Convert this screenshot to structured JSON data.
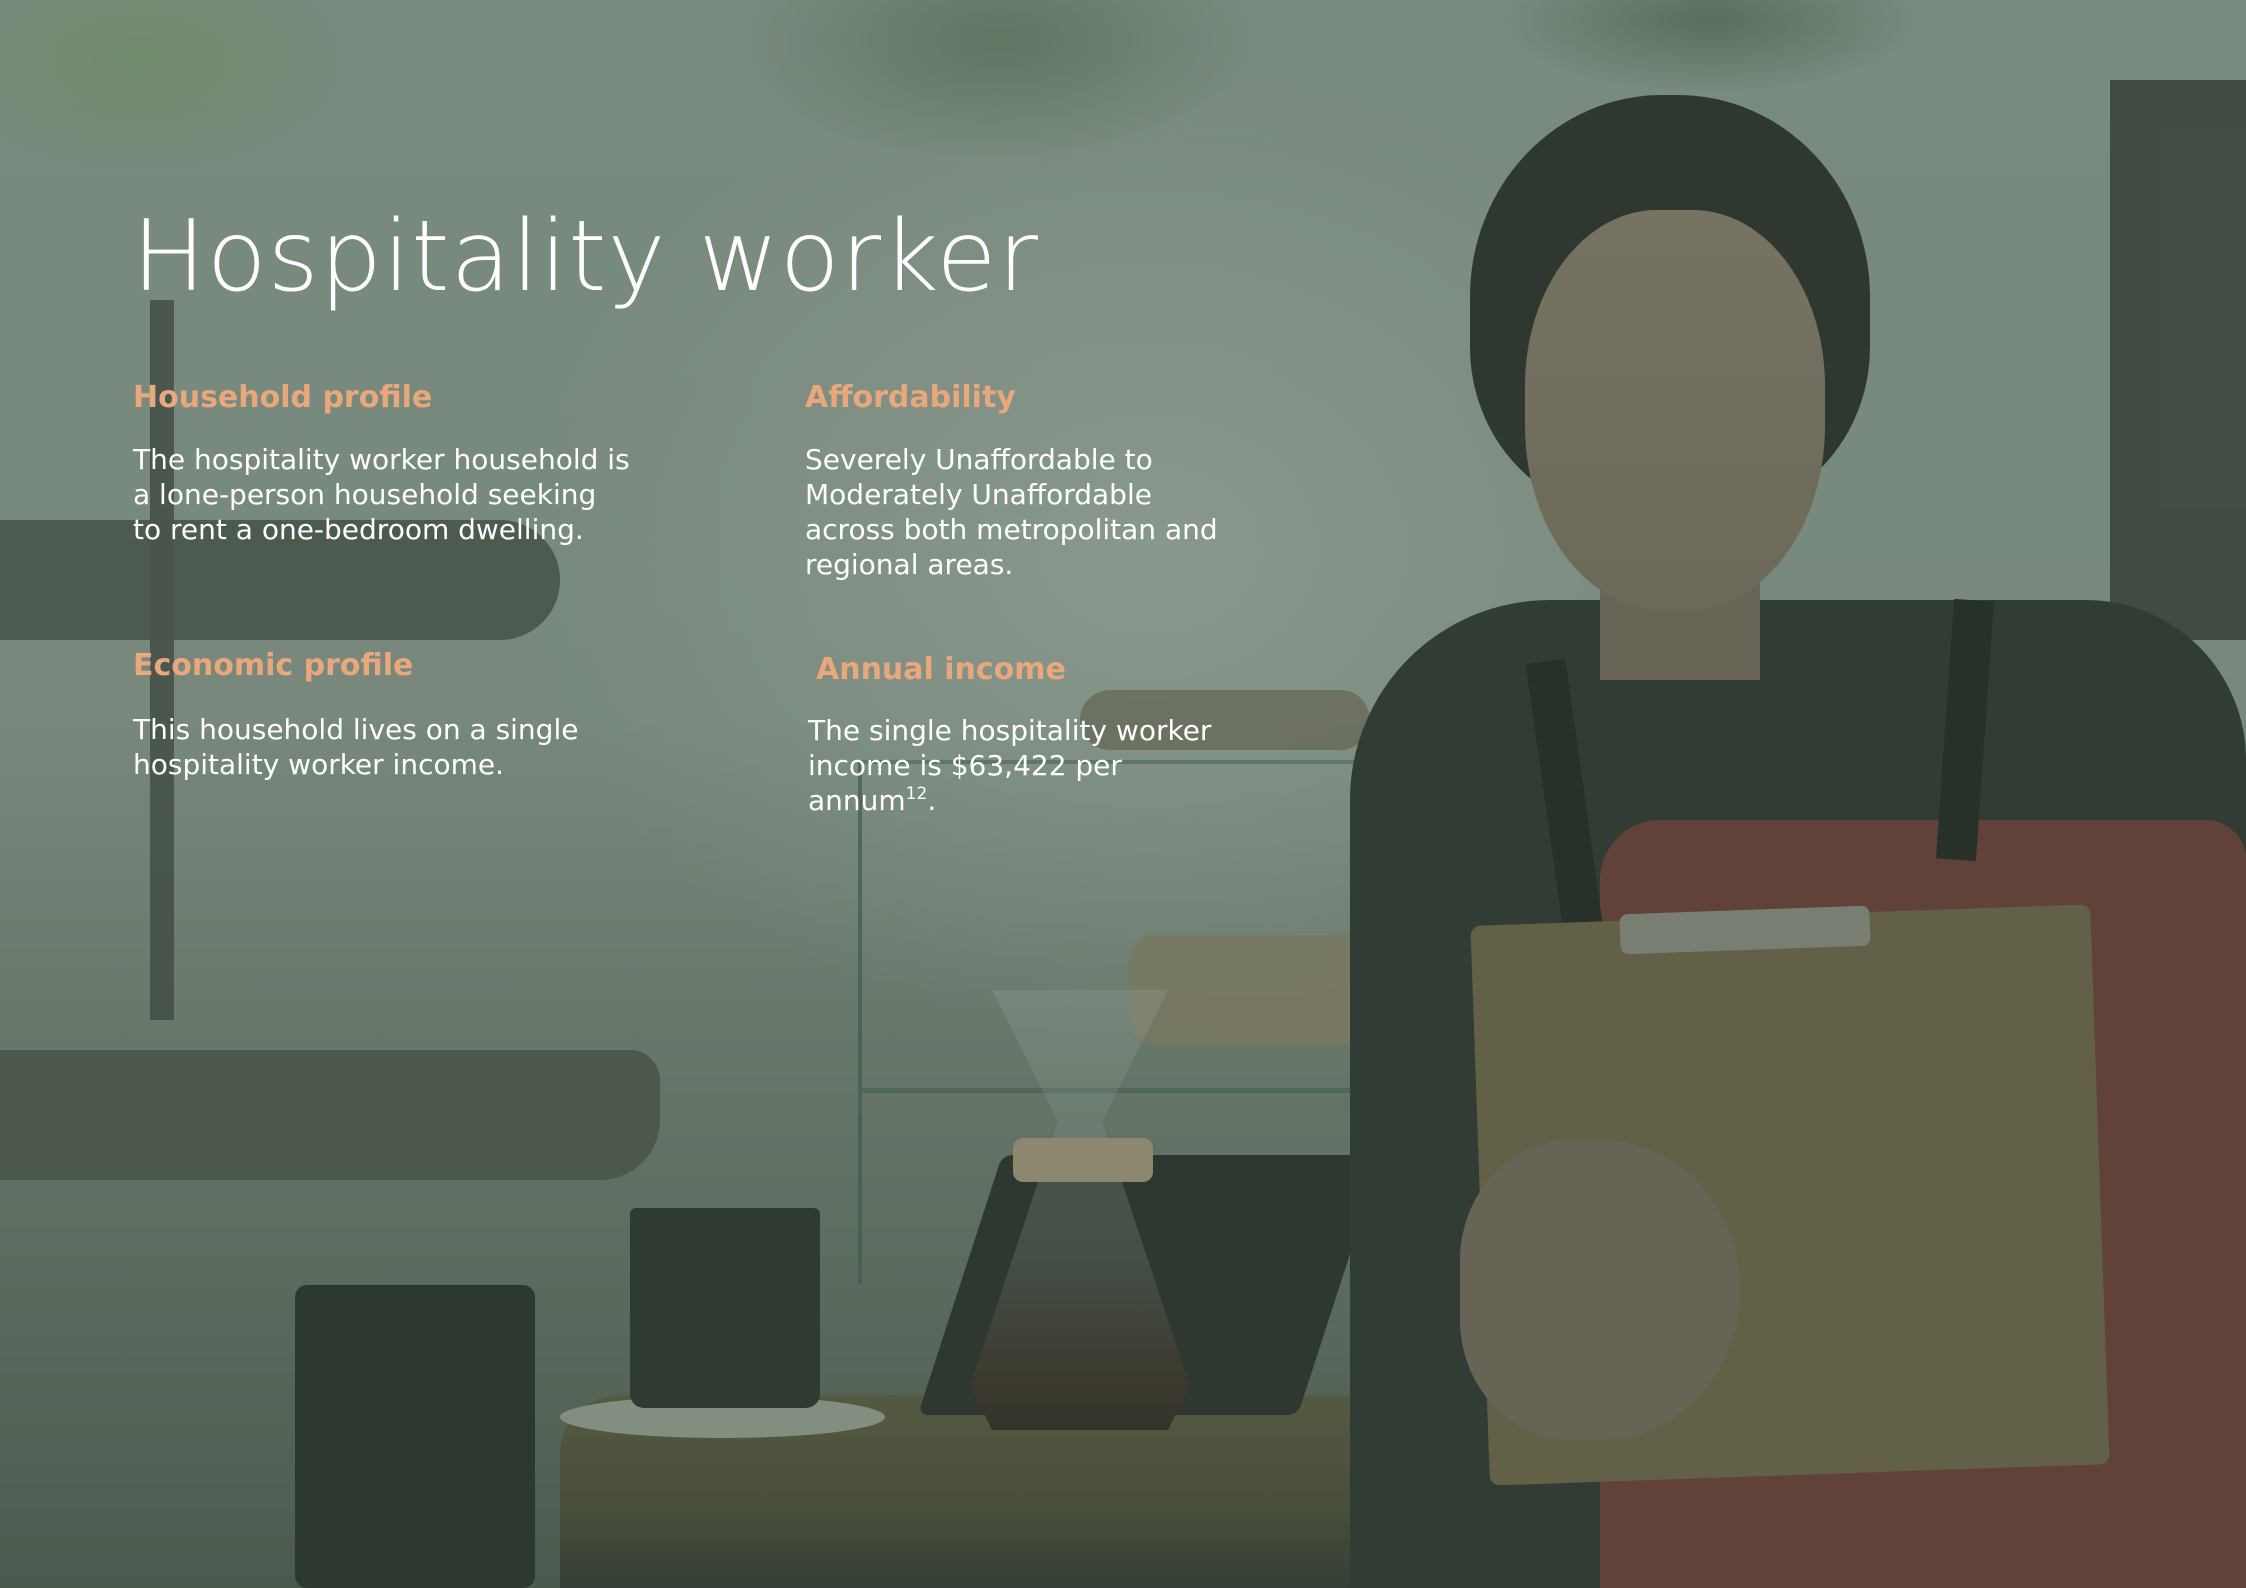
{
  "page": {
    "title": "Hospitality worker"
  },
  "sections": {
    "household_profile": {
      "heading": "Household profile",
      "lines": [
        "The hospitality worker household is",
        "a lone-person household seeking",
        "to rent a one-bedroom dwelling."
      ]
    },
    "affordability": {
      "heading": "Affordability",
      "lines": [
        "Severely Unaffordable to",
        "Moderately Unaffordable",
        "across both metropolitan and",
        "regional areas."
      ]
    },
    "economic_profile": {
      "heading": "Economic profile",
      "lines": [
        "This household lives on a single",
        "hospitality worker income."
      ]
    },
    "annual_income": {
      "heading": "Annual income",
      "lines": [
        "The single hospitality worker",
        "income is $63,422 per"
      ],
      "last_line_text": "annum",
      "footnote": "12",
      "last_line_suffix": "."
    }
  },
  "colors": {
    "heading": "#e9a77c",
    "body": "#ffffff",
    "overlay": "#46584a"
  }
}
